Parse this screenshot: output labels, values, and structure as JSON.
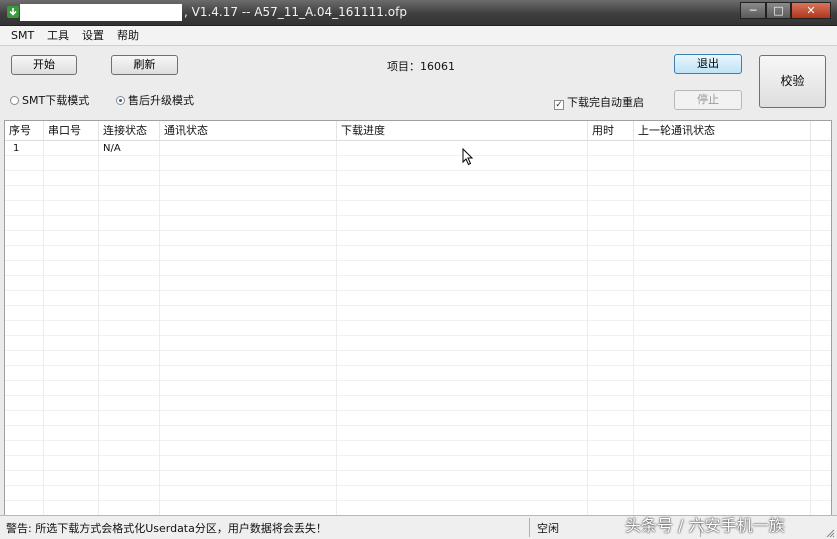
{
  "titlebar": {
    "title": ", V1.4.17 -- A57_11_A.04_161111.ofp",
    "min_glyph": "─",
    "max_glyph": "□",
    "close_glyph": "✕",
    "app_icon": "download-arrow-icon"
  },
  "menu": [
    "SMT",
    "工具",
    "设置",
    "帮助"
  ],
  "toolbar": {
    "start_label": "开始",
    "refresh_label": "刷新",
    "project_label": "项目：16061",
    "exit_label": "退出",
    "verify_label": "校验",
    "stop_label": "停止",
    "mode_smt_label": "SMT下载模式",
    "mode_aftersale_label": "售后升级模式",
    "selected_mode": "售后升级模式",
    "auto_reboot_label": "下载完自动重启",
    "auto_reboot_checked": true
  },
  "table": {
    "columns": [
      "序号",
      "串口号",
      "连接状态",
      "通讯状态",
      "下载进度",
      "用时",
      "上一轮通讯状态"
    ],
    "rows": [
      {
        "index": "1",
        "port": "",
        "connection": "N/A",
        "comm": "",
        "progress": "",
        "time": "",
        "last_comm": ""
      }
    ]
  },
  "statusbar": {
    "warning": "警告: 所选下载方式会格式化Userdata分区，用户数据将会丢失！",
    "state": "空闲"
  },
  "watermark": "头条号 / 六安手机一族",
  "colors": {
    "titlebar": "#4a4a4a",
    "close_button": "#c0462b",
    "exit_button": "#bfe3f7",
    "radio_selected": "#1d5fa8"
  }
}
